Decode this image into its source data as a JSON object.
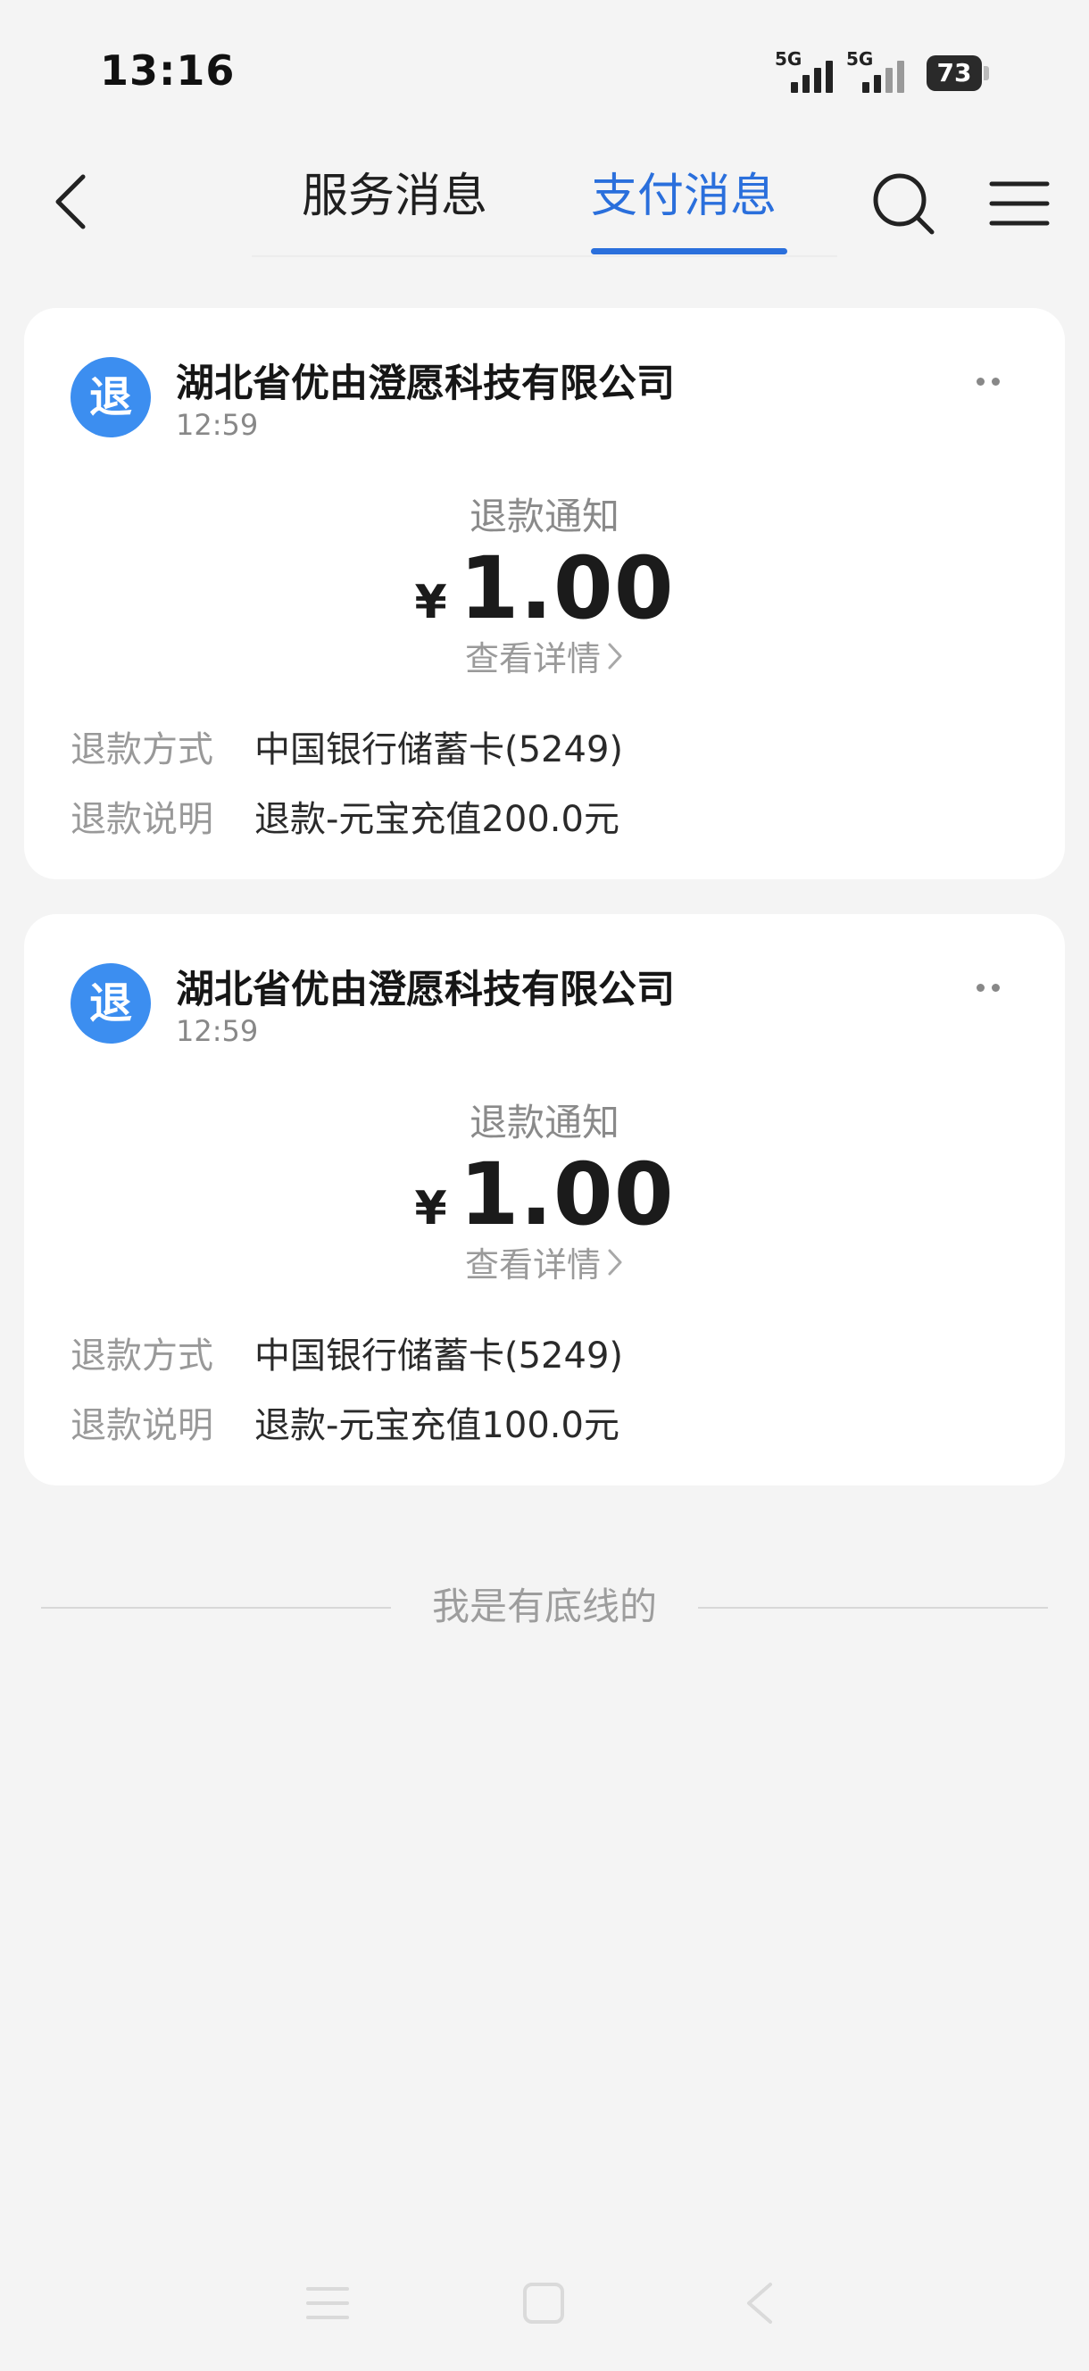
{
  "status_bar": {
    "time": "13:16",
    "signal_1": "5G",
    "signal_2": "5G",
    "battery": "73"
  },
  "nav": {
    "tabs": [
      {
        "label": "服务消息",
        "active": false
      },
      {
        "label": "支付消息",
        "active": true
      }
    ],
    "icons": [
      "back-arrow-icon",
      "search-icon",
      "menu-icon"
    ]
  },
  "messages": [
    {
      "avatar_char": "退",
      "merchant": "湖北省优由澄愿科技有限公司",
      "time": "12:59",
      "notice_title": "退款通知",
      "currency": "¥",
      "amount": "1.00",
      "detail_link": "查看详情",
      "method_label": "退款方式",
      "method_value": "中国银行储蓄卡(5249)",
      "note_label": "退款说明",
      "note_value": "退款-元宝充值200.0元"
    },
    {
      "avatar_char": "退",
      "merchant": "湖北省优由澄愿科技有限公司",
      "time": "12:59",
      "notice_title": "退款通知",
      "currency": "¥",
      "amount": "1.00",
      "detail_link": "查看详情",
      "method_label": "退款方式",
      "method_value": "中国银行储蓄卡(5249)",
      "note_label": "退款说明",
      "note_value": "退款-元宝充值100.0元"
    }
  ],
  "footer": {
    "end_text": "我是有底线的"
  },
  "colors": {
    "accent": "#2a6fdc",
    "avatar": "#3c8ef0",
    "background": "#f4f4f4"
  }
}
